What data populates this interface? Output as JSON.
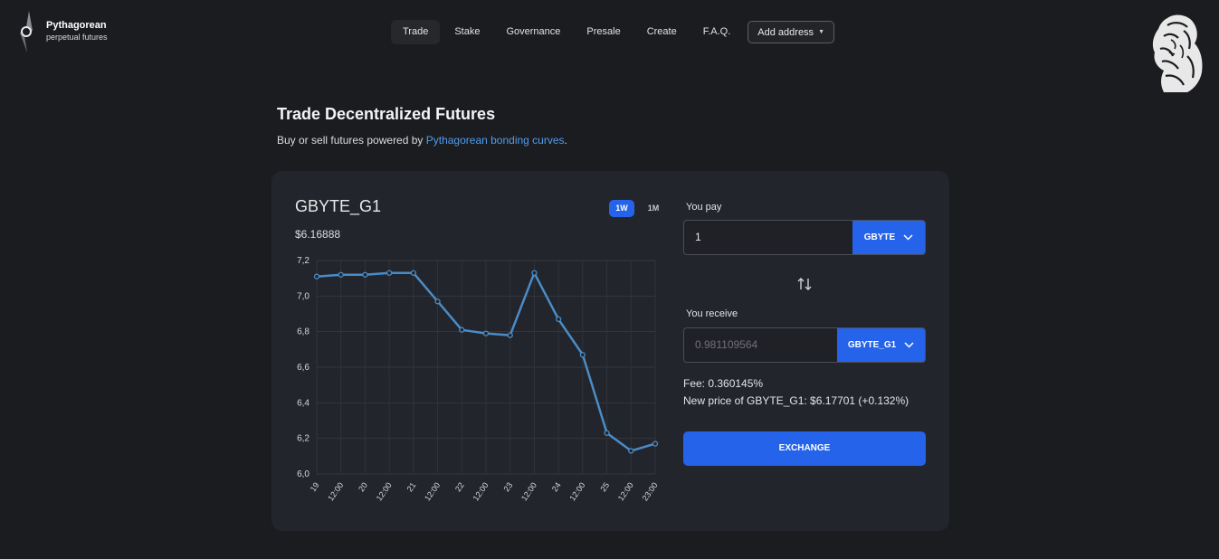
{
  "brand": {
    "title": "Pythagorean",
    "subtitle": "perpetual futures"
  },
  "nav": {
    "items": [
      "Trade",
      "Stake",
      "Governance",
      "Presale",
      "Create",
      "F.A.Q."
    ],
    "active": "Trade",
    "add_address": "Add address"
  },
  "intro": {
    "title": "Trade Decentralized Futures",
    "sub_prefix": "Buy or sell futures powered by ",
    "sub_link": "Pythagorean bonding curves",
    "sub_suffix": "."
  },
  "market": {
    "pair": "GBYTE_G1",
    "price": "$6.16888",
    "ranges": [
      "1W",
      "1M"
    ],
    "active_range": "1W"
  },
  "form": {
    "pay_label": "You pay",
    "pay_value": "1",
    "pay_token": "GBYTE",
    "receive_label": "You receive",
    "receive_placeholder": "0.981109564",
    "receive_token": "GBYTE_G1",
    "fee": "Fee: 0.360145%",
    "new_price": "New price of GBYTE_G1: $6.17701 (+0.132%)",
    "exchange_label": "EXCHANGE"
  },
  "colors": {
    "accent": "#2563eb",
    "link": "#4f9cf0",
    "line": "#4a8cc7",
    "card": "#22252b",
    "bg": "#1b1c1f"
  },
  "chart_data": {
    "type": "line",
    "title": "",
    "xlabel": "",
    "ylabel": "",
    "ylim": [
      6.0,
      7.2
    ],
    "yticks": [
      "6,0",
      "6,2",
      "6,4",
      "6,6",
      "6,8",
      "7,0",
      "7,2"
    ],
    "x": [
      "19",
      "12:00",
      "20",
      "12:00",
      "21",
      "12:00",
      "22",
      "12:00",
      "23",
      "12:00",
      "24",
      "12:00",
      "25",
      "12:00",
      "23:00"
    ],
    "values": [
      7.11,
      7.12,
      7.12,
      7.13,
      7.13,
      6.97,
      6.81,
      6.79,
      6.78,
      7.13,
      6.87,
      6.67,
      6.23,
      6.13,
      6.17
    ],
    "grid": true
  }
}
